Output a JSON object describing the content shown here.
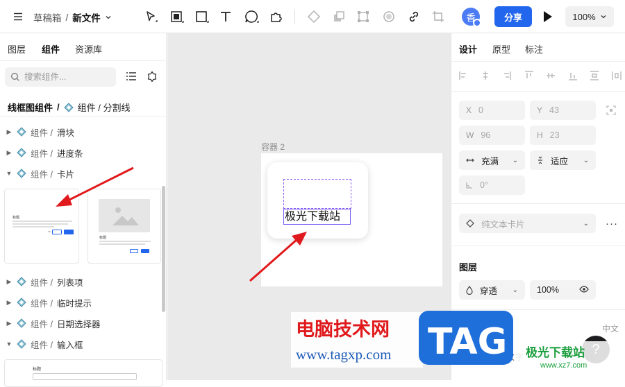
{
  "topbar": {
    "breadcrumb_root": "草稿箱",
    "breadcrumb_sep": "/",
    "file_name": "新文件",
    "avatar_text": "香",
    "share_label": "分享",
    "zoom_level": "100%"
  },
  "left_panel": {
    "tabs": [
      "图层",
      "组件",
      "资源库"
    ],
    "search_placeholder": "搜索组件...",
    "library_name": "线框图组件",
    "library_sep": "/",
    "current_path": "组件 / 分割线",
    "items": [
      {
        "prefix": "组件 /",
        "name": "滑块"
      },
      {
        "prefix": "组件 /",
        "name": "进度条"
      },
      {
        "prefix": "组件 /",
        "name": "卡片"
      },
      {
        "prefix": "组件 /",
        "name": "列表项"
      },
      {
        "prefix": "组件 /",
        "name": "临时提示"
      },
      {
        "prefix": "组件 /",
        "name": "日期选择器"
      },
      {
        "prefix": "组件 /",
        "name": "输入框"
      }
    ],
    "preview_title": "标题"
  },
  "canvas": {
    "container_label": "容器 2",
    "text_element": "极光下载站"
  },
  "right_panel": {
    "tabs": [
      "设计",
      "原型",
      "标注"
    ],
    "x_label": "X",
    "x_value": "0",
    "y_label": "Y",
    "y_value": "43",
    "w_label": "W",
    "w_value": "96",
    "h_label": "H",
    "h_value": "23",
    "width_mode": "充满",
    "height_mode": "适应",
    "rotation": "0°",
    "component_name": "纯文本卡片",
    "more": "···",
    "layer_section": "图层",
    "blend_mode": "穿透",
    "opacity": "100%",
    "font_section_label": "中文",
    "font_hint": "中文注正文文字"
  },
  "watermark": {
    "site_cn": "电脑技术网",
    "site_url": "www.tagxp.com",
    "logo": "TAG",
    "brand2": "极光下载站",
    "brand2_url": "www.xz7.com"
  },
  "colors": {
    "accent": "#2266ee",
    "selection": "#7b5cf5",
    "arrow": "#e0191c"
  }
}
